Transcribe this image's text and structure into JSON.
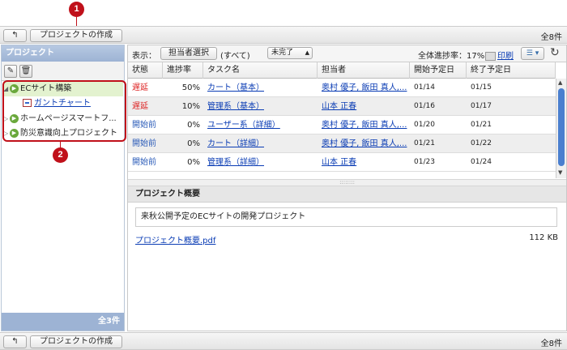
{
  "callouts": [
    "1",
    "2"
  ],
  "top_toolbar": {
    "back_icon": "back-arrow-icon",
    "create_label": "プロジェクトの作成",
    "count": "全8件"
  },
  "bottom_toolbar": {
    "back_icon": "back-arrow-icon",
    "create_label": "プロジェクトの作成",
    "count": "全8件"
  },
  "left_panel": {
    "title": "プロジェクト",
    "tools": {
      "edit_icon": "pencil-icon",
      "delete_icon": "trash-icon"
    },
    "tree": [
      {
        "label": "ECサイト構築",
        "selected": true,
        "expanded": true
      },
      {
        "label": "ガントチャート",
        "type": "gantt"
      },
      {
        "label": "ホームページスマートフ..."
      },
      {
        "label": "防災意識向上プロジェクト"
      }
    ],
    "footer_count": "全3件"
  },
  "filter_bar": {
    "display_label": "表示：",
    "assignee_button": "担当者選択",
    "all_label": "(すべて)",
    "status_select": "未完了",
    "overall_progress": "全体進捗率：17%",
    "print_label": "印刷",
    "menu_icon": "list-menu-icon",
    "reload_icon": "reload-icon"
  },
  "table": {
    "headers": [
      "状態",
      "進捗率",
      "タスク名",
      "担当者",
      "開始予定日",
      "終了予定日"
    ],
    "rows": [
      {
        "status": "遅延",
        "status_type": "late",
        "progress": "50%",
        "task": "カート（基本）",
        "assignee": "奥村 優子, 飯田 真人,...",
        "start": "01/14",
        "end": "01/15"
      },
      {
        "status": "遅延",
        "status_type": "late",
        "progress": "10%",
        "task": "管理系（基本）",
        "assignee": "山本 正春",
        "start": "01/16",
        "end": "01/17"
      },
      {
        "status": "開始前",
        "status_type": "pre",
        "progress": "0%",
        "task": "ユーザー系（詳細）",
        "assignee": "奥村 優子, 飯田 真人,...",
        "start": "01/20",
        "end": "01/21"
      },
      {
        "status": "開始前",
        "status_type": "pre",
        "progress": "0%",
        "task": "カート（詳細）",
        "assignee": "奥村 優子, 飯田 真人,...",
        "start": "01/21",
        "end": "01/22"
      },
      {
        "status": "開始前",
        "status_type": "pre",
        "progress": "0%",
        "task": "管理系（詳細）",
        "assignee": "山本 正春",
        "start": "01/23",
        "end": "01/24"
      }
    ]
  },
  "summary": {
    "title": "プロジェクト概要",
    "description": "来秋公開予定のECサイトの開発プロジェクト",
    "file_name": "プロジェクト概要.pdf",
    "file_size": "112 KB"
  },
  "colors": {
    "accent_red": "#c0101a",
    "link": "#0a3cb4",
    "header_blue": "#9db3d4",
    "selected_green": "#e3f2cf"
  }
}
